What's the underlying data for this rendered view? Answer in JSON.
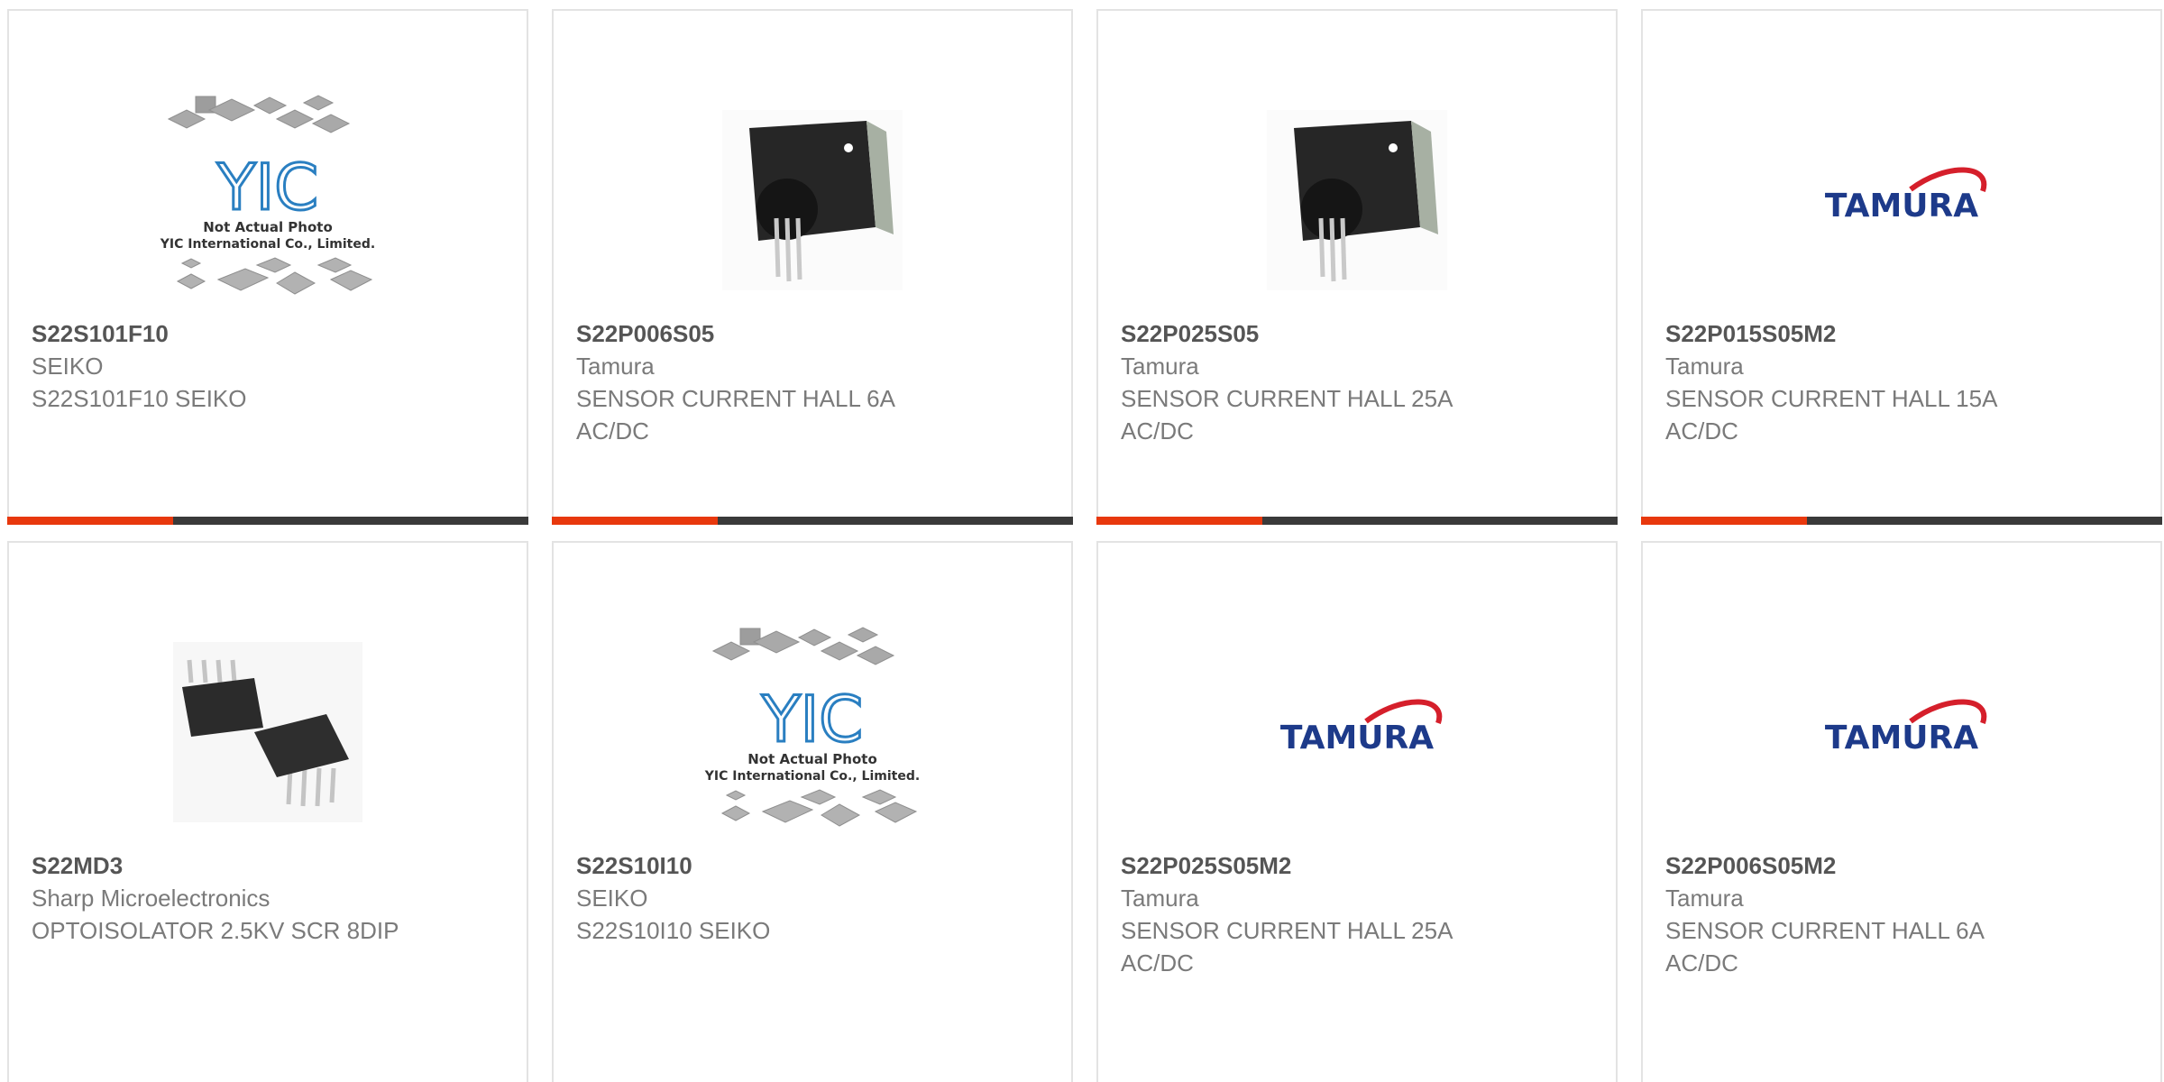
{
  "products": [
    {
      "part": "S22S101F10",
      "manufacturer": "SEIKO",
      "description": "S22S101F10 SEIKO",
      "image": "yic-placeholder"
    },
    {
      "part": "S22P006S05",
      "manufacturer": "Tamura",
      "description": "SENSOR CURRENT HALL 6A AC/DC",
      "image": "hall-sensor"
    },
    {
      "part": "S22P025S05",
      "manufacturer": "Tamura",
      "description": "SENSOR CURRENT HALL 25A AC/DC",
      "image": "hall-sensor"
    },
    {
      "part": "S22P015S05M2",
      "manufacturer": "Tamura",
      "description": "SENSOR CURRENT HALL 15A AC/DC",
      "image": "tamura-logo"
    },
    {
      "part": "S22MD3",
      "manufacturer": "Sharp Microelectronics",
      "description": "OPTOISOLATOR 2.5KV SCR 8DIP",
      "image": "dip-chips"
    },
    {
      "part": "S22S10I10",
      "manufacturer": "SEIKO",
      "description": "S22S10I10 SEIKO",
      "image": "yic-placeholder"
    },
    {
      "part": "S22P025S05M2",
      "manufacturer": "Tamura",
      "description": "SENSOR CURRENT HALL 25A AC/DC",
      "image": "tamura-logo"
    },
    {
      "part": "S22P006S05M2",
      "manufacturer": "Tamura",
      "description": "SENSOR CURRENT HALL 6A AC/DC",
      "image": "tamura-logo"
    }
  ],
  "placeholder_caption": {
    "line1": "Not Actual Photo",
    "line2": "YIC International Co., Limited."
  },
  "logo_text": {
    "yic": "YIC",
    "tamura": "TAMURA"
  },
  "colors": {
    "accent": "#e8380d",
    "bar": "#3a3a3a",
    "tamura_blue": "#1d3a8a",
    "tamura_red": "#d51f2b",
    "yic_blue": "#2a7fc1"
  }
}
